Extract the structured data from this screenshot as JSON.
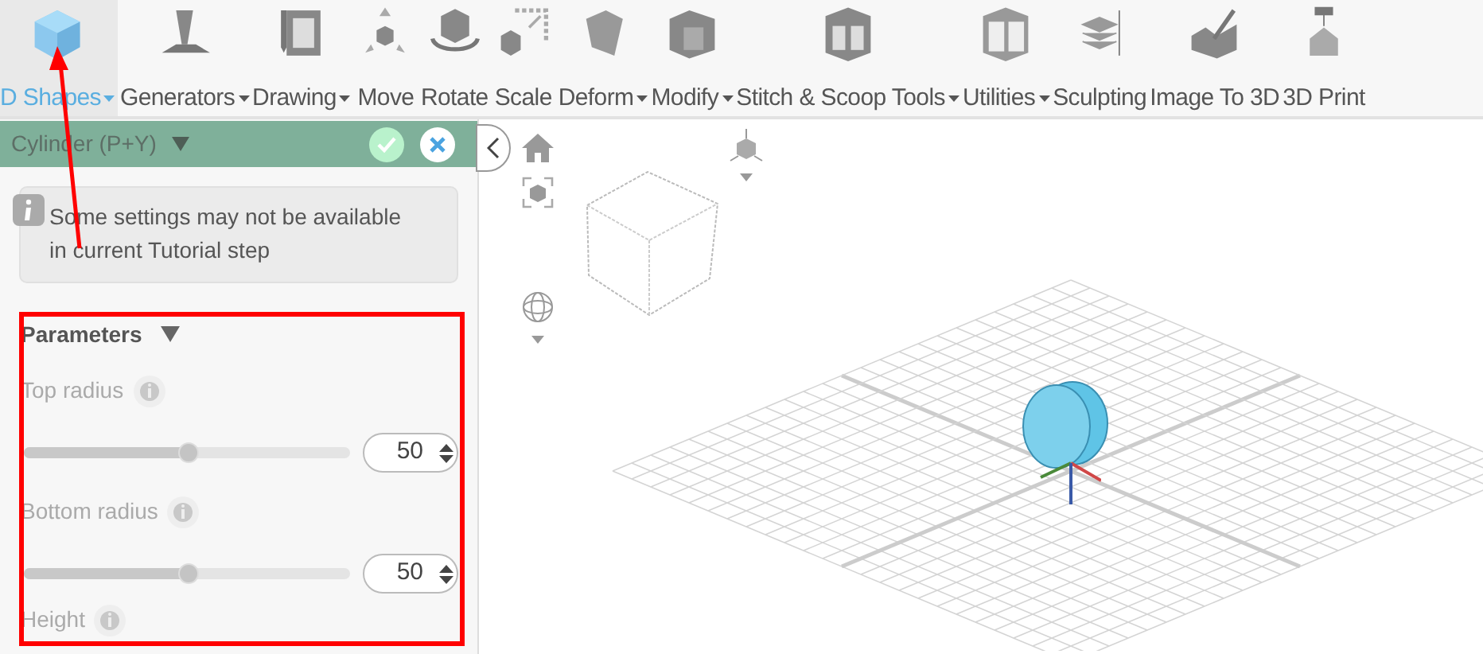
{
  "toolbar": {
    "items": [
      {
        "label": "D Shapes",
        "selected": true,
        "has_menu": true
      },
      {
        "label": "Generators",
        "selected": false,
        "has_menu": true
      },
      {
        "label": "Drawing",
        "selected": false,
        "has_menu": true
      },
      {
        "label": "Move",
        "selected": false,
        "has_menu": false
      },
      {
        "label": "Rotate",
        "selected": false,
        "has_menu": false
      },
      {
        "label": "Scale",
        "selected": false,
        "has_menu": false
      },
      {
        "label": "Deform",
        "selected": false,
        "has_menu": true
      },
      {
        "label": "Modify",
        "selected": false,
        "has_menu": true
      },
      {
        "label": "Stitch & Scoop Tools",
        "selected": false,
        "has_menu": true
      },
      {
        "label": "Utilities",
        "selected": false,
        "has_menu": true
      },
      {
        "label": "Sculpting",
        "selected": false,
        "has_menu": false
      },
      {
        "label": "Image To 3D",
        "selected": false,
        "has_menu": false
      },
      {
        "label": "3D Print",
        "selected": false,
        "has_menu": false
      }
    ]
  },
  "panel": {
    "title": "Cylinder (P+Y)",
    "notice": "Some settings may not be available in current Tutorial step",
    "section": {
      "title": "Parameters",
      "expanded": true
    },
    "params": [
      {
        "kind": "slider",
        "label": "Top radius",
        "disabled": true,
        "level": 0.5,
        "value": "50"
      },
      {
        "kind": "slider",
        "label": "Bottom radius",
        "disabled": true,
        "level": 0.5,
        "value": "50"
      },
      {
        "kind": "label",
        "label": "Height",
        "disabled": true
      }
    ]
  }
}
